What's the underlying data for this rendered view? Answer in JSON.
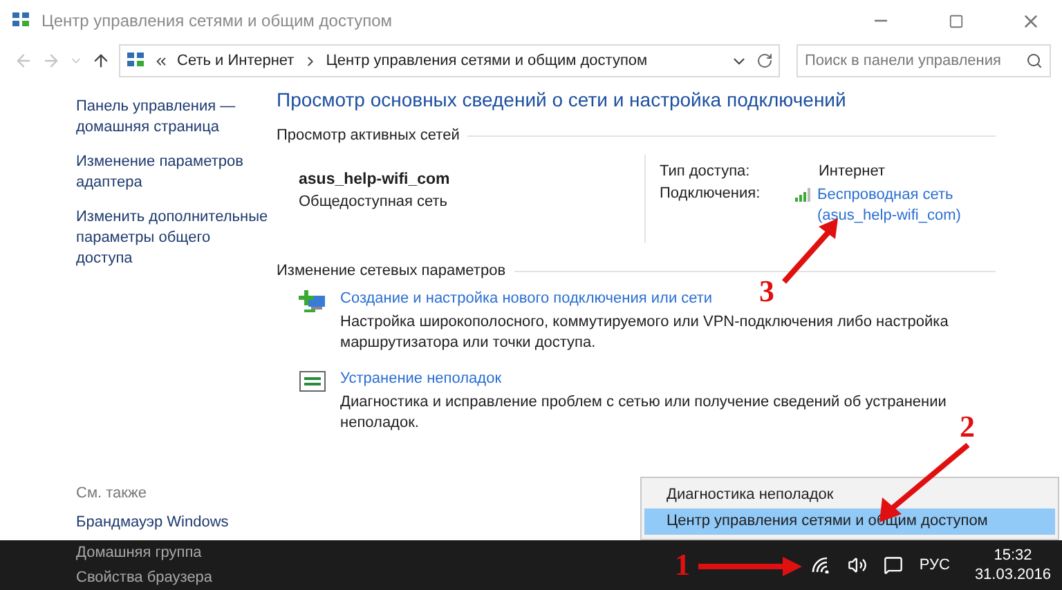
{
  "window": {
    "title": "Центр управления сетями и общим доступом"
  },
  "address_bar": {
    "breadcrumbs": [
      "Сеть и Интернет",
      "Центр управления сетями и общим доступом"
    ],
    "search": {
      "placeholder": "Поиск в панели управления"
    }
  },
  "sidebar": {
    "links": [
      "Панель управления — домашняя страница",
      "Изменение параметров адаптера",
      "Изменить дополнительные параметры общего доступа"
    ],
    "see_also": {
      "title": "См. также",
      "links": [
        "Брандмауэр Windows",
        "Домашняя группа",
        "Свойства браузера"
      ]
    }
  },
  "main": {
    "heading": "Просмотр основных сведений о сети и настройка подключений",
    "active_networks": {
      "title": "Просмотр активных сетей",
      "network_name": "asus_help-wifi_com",
      "network_type": "Общедоступная сеть",
      "access_type_label": "Тип доступа:",
      "access_type": "Интернет",
      "connections_label": "Подключения:",
      "connection_link": [
        "Беспроводная сеть",
        "(asus_help-wifi_com)"
      ]
    },
    "change_settings": {
      "title": "Изменение сетевых параметров",
      "items": [
        {
          "kind": "new-connection",
          "title": "Создание и настройка нового подключения или сети",
          "description": "Настройка широкополосного, коммутируемого или VPN-подключения либо настройка маршрутизатора или точки доступа."
        },
        {
          "kind": "troubleshoot",
          "title": "Устранение неполадок",
          "description": "Диагностика и исправление проблем с сетью или получение сведений об устранении неполадок."
        }
      ]
    }
  },
  "context_menu": {
    "items": [
      {
        "label": "Диагностика неполадок",
        "selected": false
      },
      {
        "label": "Центр управления сетями и общим доступом",
        "selected": true
      }
    ]
  },
  "taskbar": {
    "language": "РУС",
    "time": "15:32",
    "date": "31.03.2016"
  },
  "annotations": [
    {
      "label": "1"
    },
    {
      "label": "2"
    },
    {
      "label": "3"
    }
  ]
}
